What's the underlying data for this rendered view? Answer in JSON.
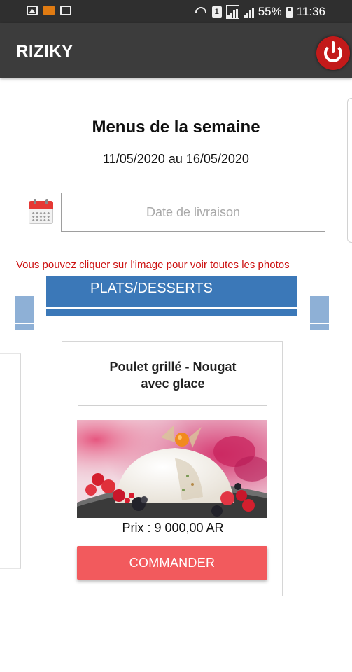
{
  "status_bar": {
    "battery": "55%",
    "time": "11:36",
    "sim_slot": "1",
    "icons": [
      "gallery-icon",
      "orange-app-icon",
      "mail-icon",
      "wifi-icon",
      "sim-icon",
      "signal-icon",
      "battery-icon"
    ]
  },
  "app_bar": {
    "title": "RIZIKY",
    "power_icon": "power-icon",
    "power_color": "#c31a1a"
  },
  "page": {
    "heading": "Menus de la semaine",
    "date_range": "11/05/2020 au 16/05/2020",
    "date_input": {
      "placeholder": "Date de livraison",
      "value": ""
    },
    "calendar_icon": "calendar-icon",
    "hint": "Vous pouvez cliquer sur l'image pour voir toutes les photos"
  },
  "tabs": {
    "active_label": "PLATS/DESSERTS",
    "color": "#3b78b8"
  },
  "product": {
    "title_line1": "Poulet grillé - Nougat",
    "title_line2": "avec glace",
    "price": "Prix : 9 000,00 AR",
    "order_label": "COMMANDER",
    "button_color": "#f25a5d"
  }
}
